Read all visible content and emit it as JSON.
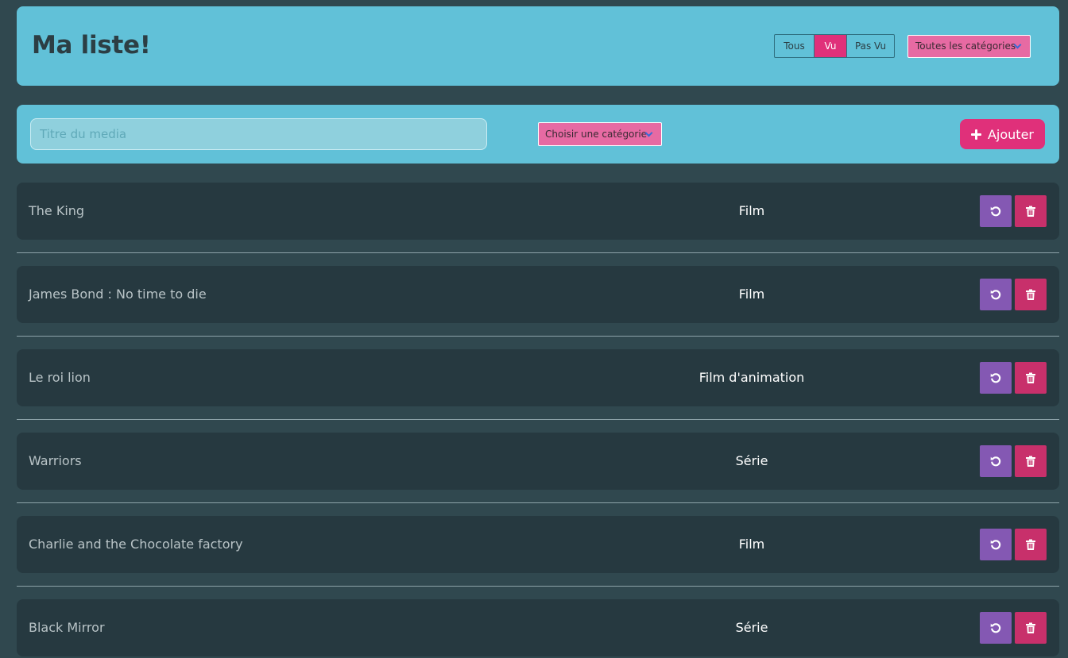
{
  "header": {
    "title": "Ma liste!",
    "filter_options": [
      "Tous",
      "Vu",
      "Pas Vu"
    ],
    "selected_filter": "Vu",
    "category_filter": "Toutes les catégories"
  },
  "form": {
    "title_placeholder": "Titre du media",
    "category_select": "Choisir une catégorie",
    "add_label": "Ajouter"
  },
  "items": [
    {
      "name": "The King",
      "category": "Film"
    },
    {
      "name": "James Bond : No time to die",
      "category": "Film"
    },
    {
      "name": "Le roi lion",
      "category": "Film d'animation"
    },
    {
      "name": "Warriors",
      "category": "Série"
    },
    {
      "name": "Charlie and the Chocolate factory",
      "category": "Film"
    },
    {
      "name": "Black Mirror",
      "category": "Série"
    }
  ],
  "icons": {
    "add": "plus-icon",
    "revert": "undo-icon",
    "delete": "trash-icon",
    "dropdown": "chevron-down-icon"
  },
  "colors": {
    "background": "#30484f",
    "panel": "#61c1d8",
    "accent_pink": "#e0307a",
    "select_pink": "#e76aa3",
    "revert_purple": "#8458b3",
    "delete_red": "#c8306b",
    "row_bg": "#263940"
  }
}
